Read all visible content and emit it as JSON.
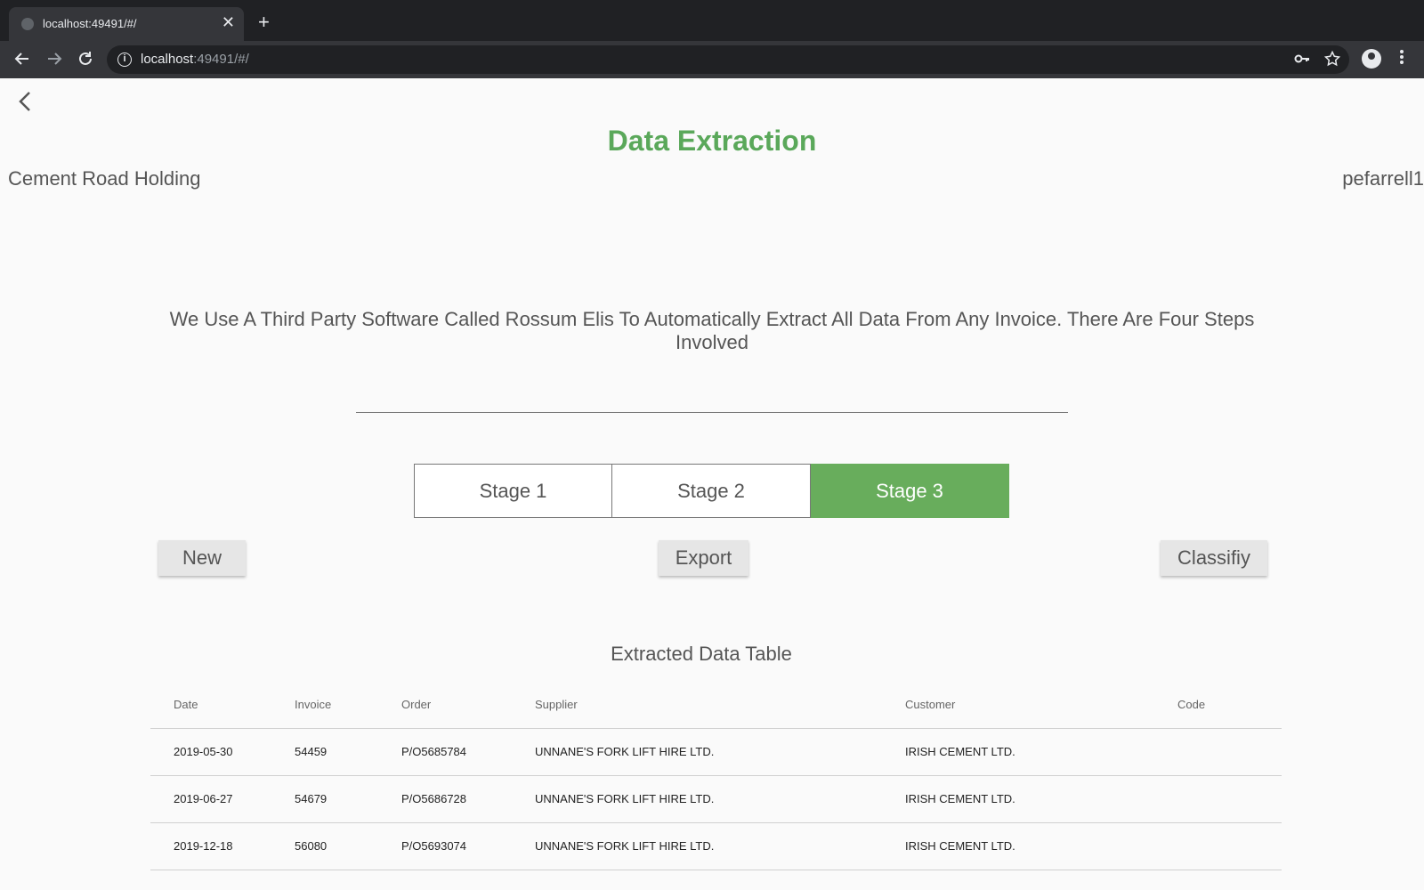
{
  "browser": {
    "tab_title": "localhost:49491/#/",
    "tab_close": "✕",
    "new_tab": "+",
    "url_host": "localhost",
    "url_rest": ":49491/#/"
  },
  "header": {
    "title": "Data Extraction",
    "company": "Cement Road Holding",
    "username": "pefarrell1"
  },
  "description": "We Use A Third Party Software Called Rossum Elis To Automatically Extract All Data From Any Invoice. There Are Four Steps Involved",
  "stages": [
    {
      "label": "Stage 1",
      "active": false
    },
    {
      "label": "Stage 2",
      "active": false
    },
    {
      "label": "Stage 3",
      "active": true
    }
  ],
  "actions": {
    "new_label": "New",
    "export_label": "Export",
    "classify_label": "Classifiy"
  },
  "table": {
    "title": "Extracted Data Table",
    "columns": [
      "Date",
      "Invoice",
      "Order",
      "Supplier",
      "Customer",
      "Code"
    ],
    "rows": [
      [
        "2019-05-30",
        "54459",
        "P/O5685784",
        "UNNANE'S FORK LIFT HIRE LTD.",
        "IRISH CEMENT LTD.",
        ""
      ],
      [
        "2019-06-27",
        "54679",
        "P/O5686728",
        "UNNANE'S FORK LIFT HIRE LTD.",
        "IRISH CEMENT LTD.",
        ""
      ],
      [
        "2019-12-18",
        "56080",
        "P/O5693074",
        "UNNANE'S FORK LIFT HIRE LTD.",
        "IRISH CEMENT LTD.",
        ""
      ]
    ]
  },
  "colors": {
    "accent": "#5aa85a",
    "stage_active": "#68ad5c"
  },
  "icons": [
    "globe-icon",
    "close-icon",
    "plus-icon",
    "back-arrow-icon",
    "forward-arrow-icon",
    "reload-icon",
    "info-icon",
    "key-icon",
    "star-icon",
    "profile-icon",
    "menu-dots-icon",
    "chevron-left-icon"
  ]
}
